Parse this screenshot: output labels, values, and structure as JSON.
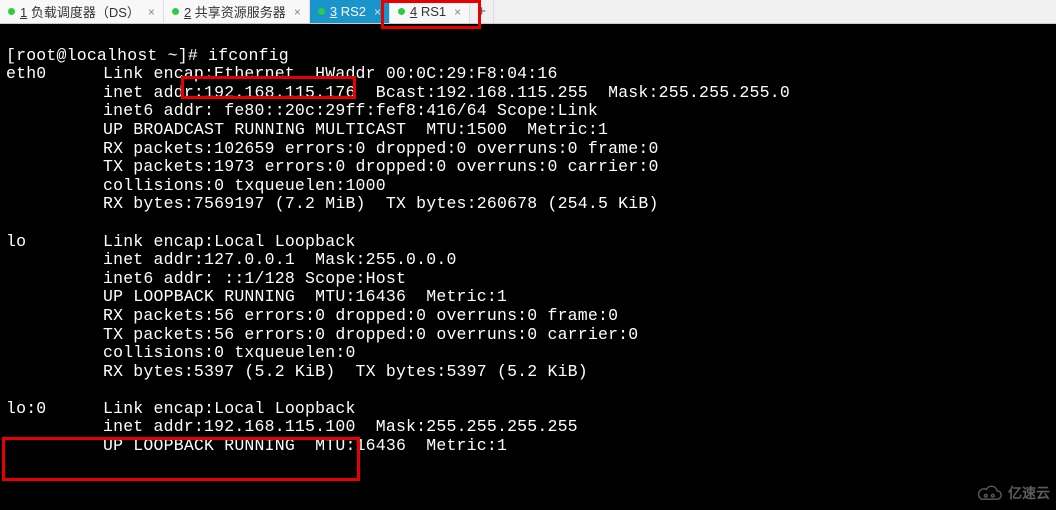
{
  "tabs": [
    {
      "num": "1",
      "label": "负载调度器（DS）",
      "active": false
    },
    {
      "num": "2",
      "label": "共享资源服务器",
      "active": false
    },
    {
      "num": "3",
      "label": "RS2",
      "active": true
    },
    {
      "num": "4",
      "label": "RS1",
      "active": false
    }
  ],
  "prompt": "[root@localhost ~]# ",
  "command": "ifconfig",
  "eth0": {
    "name": "eth0",
    "l1": "Link encap:Ethernet  HWaddr 00:0C:29:F8:04:16",
    "l2a": "inet addr",
    "l2b": ":192.168.115.176",
    "l2c": "  Bcast:192.168.115.255  Mask:255.255.255.0",
    "l3": "inet6 addr: fe80::20c:29ff:fef8:416/64 Scope:Link",
    "l4": "UP BROADCAST RUNNING MULTICAST  MTU:1500  Metric:1",
    "l5": "RX packets:102659 errors:0 dropped:0 overruns:0 frame:0",
    "l6": "TX packets:1973 errors:0 dropped:0 overruns:0 carrier:0",
    "l7": "collisions:0 txqueuelen:1000",
    "l8": "RX bytes:7569197 (7.2 MiB)  TX bytes:260678 (254.5 KiB)"
  },
  "lo": {
    "name": "lo",
    "l1": "Link encap:Local Loopback",
    "l2": "inet addr:127.0.0.1  Mask:255.0.0.0",
    "l3": "inet6 addr: ::1/128 Scope:Host",
    "l4": "UP LOOPBACK RUNNING  MTU:16436  Metric:1",
    "l5": "RX packets:56 errors:0 dropped:0 overruns:0 frame:0",
    "l6": "TX packets:56 errors:0 dropped:0 overruns:0 carrier:0",
    "l7": "collisions:0 txqueuelen:0",
    "l8": "RX bytes:5397 (5.2 KiB)  TX bytes:5397 (5.2 KiB)"
  },
  "lo0": {
    "name": "lo:0",
    "l1": "Link encap:Local Loopback",
    "l2a": "inet addr:192.168.115.100",
    "l2b": "  Mask:255.255.255.255",
    "l3": "UP LOOPBACK RUNNING  MTU:16436  Metric:1"
  },
  "watermark": "亿速云"
}
